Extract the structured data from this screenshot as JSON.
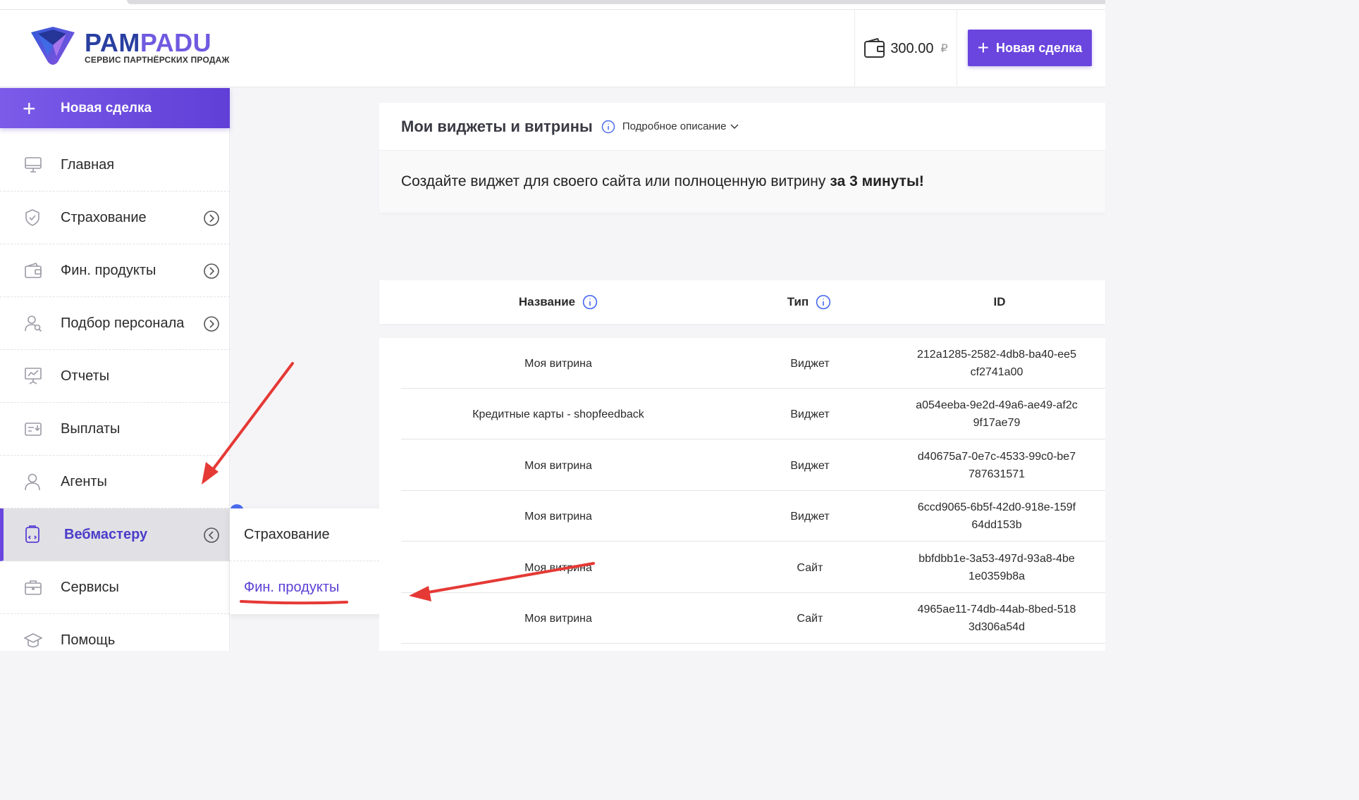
{
  "colors": {
    "accent": "#6a45de",
    "active_text": "#4b3cc9",
    "arrow": "#e53935",
    "info": "#4a6cf0"
  },
  "header": {
    "logo": {
      "word_part1": "PAM",
      "word_part2": "PADU",
      "tagline": "СЕРВИС ПАРТНЁРСКИХ ПРОДАЖ"
    },
    "balance": {
      "icon": "wallet-icon",
      "amount": "300.00",
      "currency": "₽"
    },
    "new_deal_label": "Новая сделка"
  },
  "sidebar": {
    "new_deal_label": "Новая сделка",
    "items": [
      {
        "label": "Главная",
        "icon": "monitor-icon",
        "has_chevron": false
      },
      {
        "label": "Страхование",
        "icon": "shield-icon",
        "has_chevron": true
      },
      {
        "label": "Фин. продукты",
        "icon": "wallet-card-icon",
        "has_chevron": true
      },
      {
        "label": "Подбор персонала",
        "icon": "user-search-icon",
        "has_chevron": true
      },
      {
        "label": "Отчеты",
        "icon": "presentation-chart-icon",
        "has_chevron": false
      },
      {
        "label": "Выплаты",
        "icon": "payout-icon",
        "has_chevron": false
      },
      {
        "label": "Агенты",
        "icon": "user-icon",
        "has_chevron": false
      },
      {
        "label": "Вебмастеру",
        "icon": "tablet-code-icon",
        "has_chevron": true,
        "active": true
      },
      {
        "label": "Сервисы",
        "icon": "briefcase-icon",
        "has_chevron": false
      },
      {
        "label": "Помощь",
        "icon": "graduation-cap-icon",
        "has_chevron": false
      }
    ]
  },
  "submenu": {
    "items": [
      "Страхование",
      "Фин. продукты"
    ]
  },
  "widgets_card": {
    "title": "Мои виджеты и витрины",
    "details_link": "Подробное описание",
    "description": "Создайте виджет для своего сайта или полноценную витрину",
    "description_bold": "за 3 минуты!"
  },
  "table": {
    "columns": {
      "name": "Название",
      "type": "Тип",
      "id": "ID"
    },
    "rows": [
      {
        "name": "Моя витрина",
        "type": "Виджет",
        "id": "212a1285-2582-4db8-ba40-ee5cf2741a00"
      },
      {
        "name": "Кредитные карты - shopfeedback",
        "type": "Виджет",
        "id": "a054eeba-9e2d-49a6-ae49-af2c9f17ae79"
      },
      {
        "name": "Моя витрина",
        "type": "Виджет",
        "id": "d40675a7-0e7c-4533-99c0-be7787631571"
      },
      {
        "name": "Моя витрина",
        "type": "Виджет",
        "id": "6ccd9065-6b5f-42d0-918e-159f64dd153b"
      },
      {
        "name": "Моя витрина",
        "type": "Сайт",
        "id": "bbfdbb1e-3a53-497d-93a8-4be1e0359b8a"
      },
      {
        "name": "Моя витрина",
        "type": "Сайт",
        "id": "4965ae11-74db-44ab-8bed-5183d306a54d"
      }
    ]
  }
}
